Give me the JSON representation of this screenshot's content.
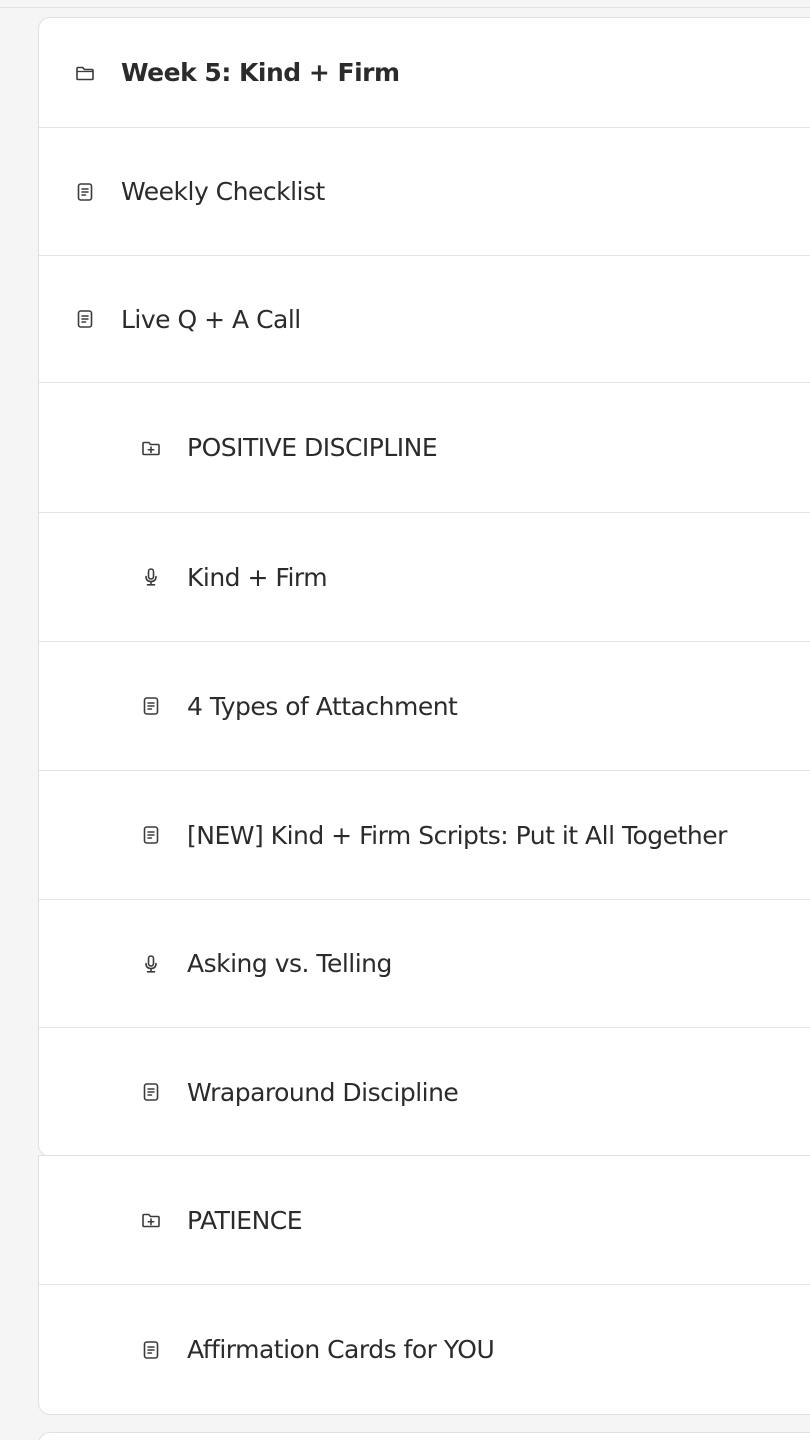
{
  "module": {
    "title": "Week 5: Kind + Firm",
    "items": [
      {
        "label": "Weekly Checklist",
        "icon": "document-icon"
      },
      {
        "label": "Live Q + A Call",
        "icon": "document-icon"
      }
    ]
  },
  "sections": [
    {
      "title": "POSITIVE DISCIPLINE",
      "icon": "folder-plus-icon",
      "items": [
        {
          "label": "Kind + Firm",
          "icon": "microphone-icon"
        },
        {
          "label": "4 Types of Attachment",
          "icon": "document-icon"
        },
        {
          "label": "[NEW] Kind + Firm Scripts: Put it All Together",
          "icon": "document-icon"
        },
        {
          "label": "Asking vs. Telling",
          "icon": "microphone-icon"
        },
        {
          "label": "Wraparound Discipline",
          "icon": "document-icon"
        }
      ]
    },
    {
      "title": "PATIENCE",
      "icon": "folder-plus-icon",
      "items": [
        {
          "label": "Affirmation Cards for YOU",
          "icon": "document-icon"
        }
      ]
    }
  ]
}
